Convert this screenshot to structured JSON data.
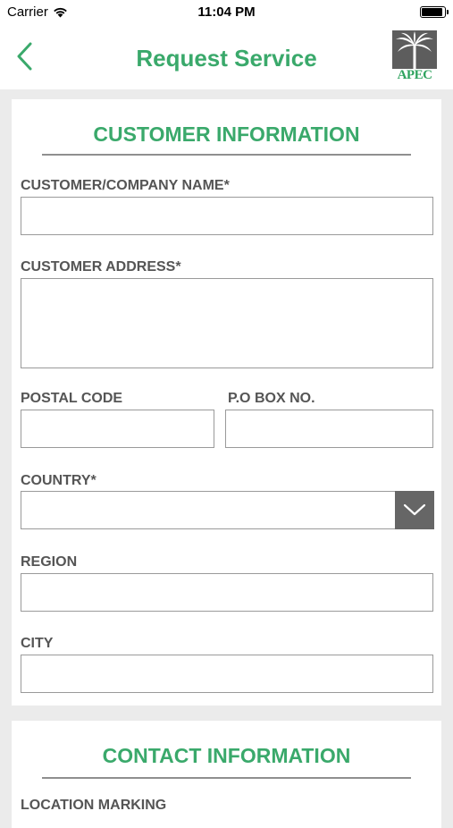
{
  "status_bar": {
    "carrier": "Carrier",
    "time": "11:04 PM"
  },
  "nav": {
    "title": "Request Service",
    "logo_text": "APEC",
    "icons": {
      "back": "chevron-left-icon",
      "logo": "palm-tree-logo"
    }
  },
  "colors": {
    "accent": "#3aa96b",
    "label": "#555555",
    "border": "#9a9a9a",
    "dropdown": "#666666",
    "background": "#ebebeb"
  },
  "customer_info": {
    "title": "CUSTOMER INFORMATION",
    "fields": {
      "company_name": {
        "label": "CUSTOMER/COMPANY NAME*",
        "value": ""
      },
      "address": {
        "label": "CUSTOMER ADDRESS*",
        "value": ""
      },
      "postal_code": {
        "label": "POSTAL CODE",
        "value": ""
      },
      "po_box": {
        "label": "P.O BOX NO.",
        "value": ""
      },
      "country": {
        "label": "COUNTRY*",
        "value": "",
        "icon": "chevron-down-icon"
      },
      "region": {
        "label": "REGION",
        "value": ""
      },
      "city": {
        "label": "CITY",
        "value": ""
      }
    }
  },
  "contact_info": {
    "title": "CONTACT INFORMATION",
    "first_label": "LOCATION MARKING"
  }
}
